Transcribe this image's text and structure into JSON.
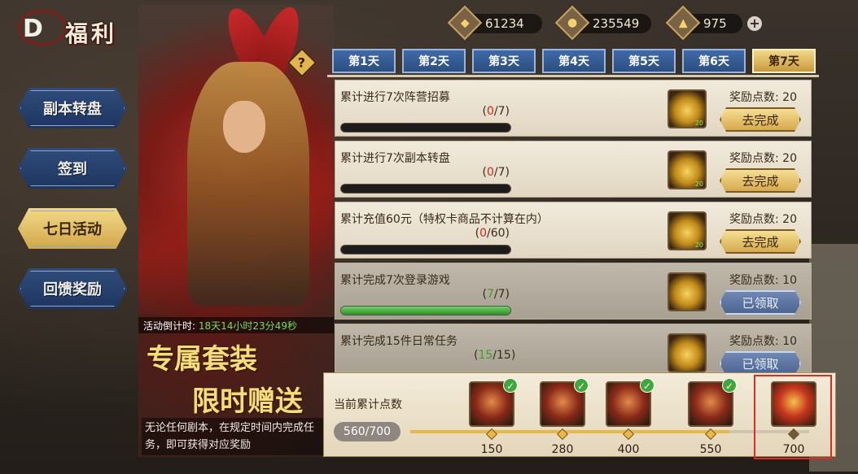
{
  "title": "福利",
  "logo_letter": "D",
  "sidebar": {
    "items": [
      {
        "label": "副本转盘",
        "active": false
      },
      {
        "label": "签到",
        "active": false
      },
      {
        "label": "七日活动",
        "active": true
      },
      {
        "label": "回馈奖励",
        "active": false
      }
    ]
  },
  "currency": [
    {
      "icon": "coin-diamond-icon",
      "value": "61234"
    },
    {
      "icon": "gold-bag-icon",
      "value": "235549"
    },
    {
      "icon": "gold-ingot-icon",
      "value": "975"
    }
  ],
  "hero": {
    "countdown_label": "活动倒计时:",
    "countdown_value": "18天14小时23分49秒",
    "promo_line1": "专属套装",
    "promo_line2": "限时赠送",
    "promo_desc": "无论任何剧本，在规定时间内完成任务，即可获得对应奖励"
  },
  "tabs": [
    "第1天",
    "第2天",
    "第3天",
    "第4天",
    "第5天",
    "第6天",
    "第7天"
  ],
  "active_tab": 6,
  "tasks": [
    {
      "name": "累计进行7次阵营招募",
      "current": "0",
      "total": "/7",
      "progress": 0,
      "reward_count": "20",
      "points_label": "奖励点数: 20",
      "button": "去完成",
      "done": false
    },
    {
      "name": "累计进行7次副本转盘",
      "current": "0",
      "total": "/7",
      "progress": 0,
      "reward_count": "20",
      "points_label": "奖励点数: 20",
      "button": "去完成",
      "done": false
    },
    {
      "name": "累计充值60元（特权卡商品不计算在内）",
      "current": "0",
      "total": "/60",
      "progress": 0,
      "reward_count": "20",
      "points_label": "奖励点数: 20",
      "button": "去完成",
      "done": false
    },
    {
      "name": "累计完成7次登录游戏",
      "current": "7",
      "total": "/7",
      "progress": 1,
      "reward_count": "",
      "points_label": "奖励点数: 10",
      "button": "已领取",
      "done": true
    },
    {
      "name": "累计完成15件日常任务",
      "current": "15",
      "total": "/15",
      "progress": 1,
      "reward_count": "",
      "points_label": "奖励点数: 10",
      "button": "已领取",
      "done": true
    }
  ],
  "track": {
    "label": "当前累计点数",
    "score": "560/700",
    "progress": 0.8,
    "milestones": [
      {
        "value": "150",
        "claimed": true
      },
      {
        "value": "280",
        "claimed": true
      },
      {
        "value": "400",
        "claimed": true
      },
      {
        "value": "550",
        "claimed": true
      },
      {
        "value": "700",
        "claimed": false
      }
    ]
  },
  "colors": {
    "accent_gold": "#e8b94a",
    "tab_blue": "#3f6aa8",
    "progress_red": "#d4261a",
    "progress_green": "#3aa126",
    "highlight_red": "#e02a22"
  }
}
